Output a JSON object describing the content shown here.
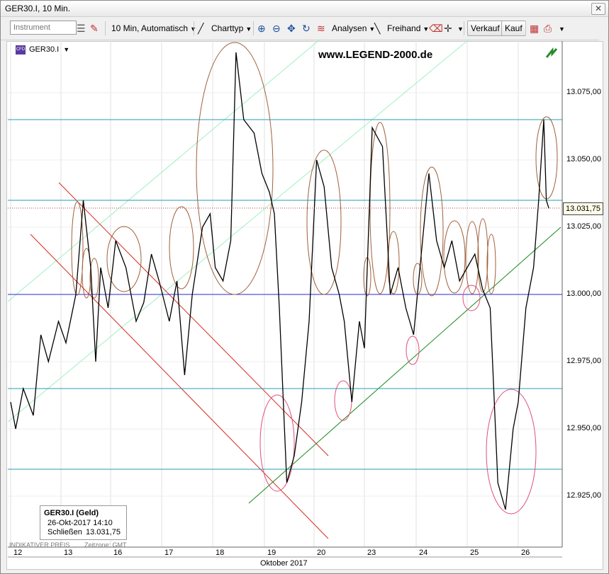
{
  "window": {
    "title": "GER30.I, 10 Min.",
    "close_glyph": "✕"
  },
  "toolbar": {
    "instrument_placeholder": "Instrument",
    "interval": "10 Min,",
    "interval_mode": "Automatisch",
    "charttype": "Charttyp",
    "analysen": "Analysen",
    "freihand": "Freihand",
    "verkauf": "Verkauf",
    "kauf": "Kauf"
  },
  "chart": {
    "symbol": "GER30.I",
    "watermark": "www.LEGEND-2000.de",
    "last_price_tag": "13.031,75",
    "indicative": "INDIKATIVER PREIS",
    "timezone": "Zeitzone: GMT",
    "month_label": "Oktober 2017",
    "info_box": {
      "name": "GER30.I (Geld)",
      "datetime": "26-Okt-2017 14:10",
      "close_label": "Schließen",
      "close_value": "13.031,75"
    },
    "colors": {
      "price_line": "#000000",
      "support_green": "#1a8a1a",
      "channel_red": "#d42a1e",
      "channel_light_green": "#7ee8a8",
      "horizontal_teal": "#2a9cb0",
      "horizontal_blue": "#2a2ad0",
      "ellipse_brown": "#a0603a",
      "ellipse_pink": "#e0507a"
    }
  },
  "chart_data": {
    "type": "line",
    "title": "GER30.I, 10 Min.",
    "xlabel": "Oktober 2017",
    "ylabel": "",
    "x_ticks": [
      "12",
      "13",
      "16",
      "17",
      "18",
      "19",
      "20",
      "23",
      "24",
      "25",
      "26"
    ],
    "y_ticks": [
      "13.075,00",
      "13.050,00",
      "13.025,00",
      "13.000,00",
      "12.975,00",
      "12.950,00",
      "12.925,00"
    ],
    "ylim": [
      12910,
      13090
    ],
    "last_close": 13031.75,
    "horizontal_levels": [
      13065,
      13035,
      13000,
      12965,
      12935
    ],
    "series": [
      {
        "name": "GER30.I",
        "points": [
          [
            0.0,
            12960
          ],
          [
            0.1,
            12950
          ],
          [
            0.25,
            12965
          ],
          [
            0.45,
            12955
          ],
          [
            0.6,
            12985
          ],
          [
            0.75,
            12975
          ],
          [
            0.95,
            12990
          ],
          [
            1.1,
            12982
          ],
          [
            1.3,
            13000
          ],
          [
            1.45,
            13035
          ],
          [
            1.6,
            13010
          ],
          [
            1.7,
            12975
          ],
          [
            1.8,
            13010
          ],
          [
            1.95,
            12995
          ],
          [
            2.1,
            13020
          ],
          [
            2.3,
            13010
          ],
          [
            2.5,
            12990
          ],
          [
            2.65,
            12997
          ],
          [
            2.8,
            13015
          ],
          [
            2.95,
            13005
          ],
          [
            3.15,
            12990
          ],
          [
            3.3,
            13005
          ],
          [
            3.45,
            12970
          ],
          [
            3.6,
            13000
          ],
          [
            3.8,
            13025
          ],
          [
            3.95,
            13030
          ],
          [
            4.05,
            13010
          ],
          [
            4.2,
            13005
          ],
          [
            4.35,
            13020
          ],
          [
            4.45,
            13090
          ],
          [
            4.6,
            13065
          ],
          [
            4.8,
            13060
          ],
          [
            4.95,
            13045
          ],
          [
            5.1,
            13038
          ],
          [
            5.2,
            13030
          ],
          [
            5.3,
            12995
          ],
          [
            5.45,
            12930
          ],
          [
            5.6,
            12940
          ],
          [
            5.75,
            12960
          ],
          [
            5.9,
            12990
          ],
          [
            6.05,
            13050
          ],
          [
            6.2,
            13040
          ],
          [
            6.35,
            13010
          ],
          [
            6.5,
            13000
          ],
          [
            6.6,
            12990
          ],
          [
            6.75,
            12960
          ],
          [
            6.9,
            12990
          ],
          [
            7.0,
            12980
          ],
          [
            7.15,
            13062
          ],
          [
            7.35,
            13055
          ],
          [
            7.5,
            13000
          ],
          [
            7.65,
            13010
          ],
          [
            7.8,
            12995
          ],
          [
            7.95,
            12985
          ],
          [
            8.1,
            13015
          ],
          [
            8.25,
            13045
          ],
          [
            8.4,
            13020
          ],
          [
            8.55,
            13010
          ],
          [
            8.7,
            13020
          ],
          [
            8.85,
            13005
          ],
          [
            9.0,
            13010
          ],
          [
            9.15,
            13015
          ],
          [
            9.3,
            13002
          ],
          [
            9.45,
            12995
          ],
          [
            9.6,
            12930
          ],
          [
            9.75,
            12920
          ],
          [
            9.9,
            12950
          ],
          [
            10.0,
            12960
          ],
          [
            10.15,
            12995
          ],
          [
            10.3,
            13010
          ],
          [
            10.4,
            13035
          ],
          [
            10.5,
            13065
          ],
          [
            10.55,
            13035
          ],
          [
            10.6,
            13032
          ]
        ]
      }
    ],
    "annotations": [
      {
        "type": "trendline",
        "label": "support",
        "color": "green"
      },
      {
        "type": "channel",
        "label": "descending",
        "color": "red"
      },
      {
        "type": "channel",
        "label": "ascending",
        "color": "light-green"
      },
      {
        "type": "ellipses",
        "label": "turning points",
        "color": "brown"
      },
      {
        "type": "ellipses",
        "label": "lows",
        "color": "pink"
      }
    ],
    "grid": true,
    "legend": "none"
  }
}
